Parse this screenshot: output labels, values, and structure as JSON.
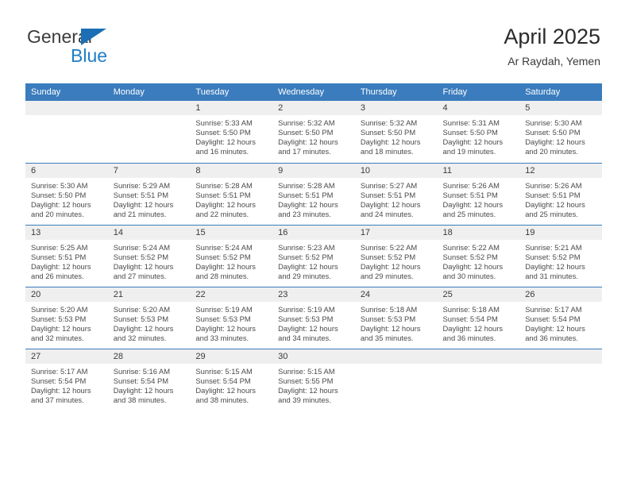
{
  "brand": {
    "line1": "General",
    "line2": "Blue",
    "triangle_color": "#1c6fb5",
    "line2_color": "#1f7ec4"
  },
  "header": {
    "title": "April 2025",
    "subtitle": "Ar Raydah, Yemen"
  },
  "colors": {
    "header_blue": "#3a7cbd",
    "daynum_band": "#efefef",
    "text": "#4a4a4a"
  },
  "weekdays": [
    "Sunday",
    "Monday",
    "Tuesday",
    "Wednesday",
    "Thursday",
    "Friday",
    "Saturday"
  ],
  "labels": {
    "sunrise": "Sunrise:",
    "sunset": "Sunset:",
    "daylight": "Daylight:"
  },
  "weeks": [
    [
      {
        "day": "",
        "sunrise": "",
        "sunset": "",
        "daylight_line1": "",
        "daylight_line2": ""
      },
      {
        "day": "",
        "sunrise": "",
        "sunset": "",
        "daylight_line1": "",
        "daylight_line2": ""
      },
      {
        "day": "1",
        "sunrise": "Sunrise: 5:33 AM",
        "sunset": "Sunset: 5:50 PM",
        "daylight_line1": "Daylight: 12 hours",
        "daylight_line2": "and 16 minutes."
      },
      {
        "day": "2",
        "sunrise": "Sunrise: 5:32 AM",
        "sunset": "Sunset: 5:50 PM",
        "daylight_line1": "Daylight: 12 hours",
        "daylight_line2": "and 17 minutes."
      },
      {
        "day": "3",
        "sunrise": "Sunrise: 5:32 AM",
        "sunset": "Sunset: 5:50 PM",
        "daylight_line1": "Daylight: 12 hours",
        "daylight_line2": "and 18 minutes."
      },
      {
        "day": "4",
        "sunrise": "Sunrise: 5:31 AM",
        "sunset": "Sunset: 5:50 PM",
        "daylight_line1": "Daylight: 12 hours",
        "daylight_line2": "and 19 minutes."
      },
      {
        "day": "5",
        "sunrise": "Sunrise: 5:30 AM",
        "sunset": "Sunset: 5:50 PM",
        "daylight_line1": "Daylight: 12 hours",
        "daylight_line2": "and 20 minutes."
      }
    ],
    [
      {
        "day": "6",
        "sunrise": "Sunrise: 5:30 AM",
        "sunset": "Sunset: 5:50 PM",
        "daylight_line1": "Daylight: 12 hours",
        "daylight_line2": "and 20 minutes."
      },
      {
        "day": "7",
        "sunrise": "Sunrise: 5:29 AM",
        "sunset": "Sunset: 5:51 PM",
        "daylight_line1": "Daylight: 12 hours",
        "daylight_line2": "and 21 minutes."
      },
      {
        "day": "8",
        "sunrise": "Sunrise: 5:28 AM",
        "sunset": "Sunset: 5:51 PM",
        "daylight_line1": "Daylight: 12 hours",
        "daylight_line2": "and 22 minutes."
      },
      {
        "day": "9",
        "sunrise": "Sunrise: 5:28 AM",
        "sunset": "Sunset: 5:51 PM",
        "daylight_line1": "Daylight: 12 hours",
        "daylight_line2": "and 23 minutes."
      },
      {
        "day": "10",
        "sunrise": "Sunrise: 5:27 AM",
        "sunset": "Sunset: 5:51 PM",
        "daylight_line1": "Daylight: 12 hours",
        "daylight_line2": "and 24 minutes."
      },
      {
        "day": "11",
        "sunrise": "Sunrise: 5:26 AM",
        "sunset": "Sunset: 5:51 PM",
        "daylight_line1": "Daylight: 12 hours",
        "daylight_line2": "and 25 minutes."
      },
      {
        "day": "12",
        "sunrise": "Sunrise: 5:26 AM",
        "sunset": "Sunset: 5:51 PM",
        "daylight_line1": "Daylight: 12 hours",
        "daylight_line2": "and 25 minutes."
      }
    ],
    [
      {
        "day": "13",
        "sunrise": "Sunrise: 5:25 AM",
        "sunset": "Sunset: 5:51 PM",
        "daylight_line1": "Daylight: 12 hours",
        "daylight_line2": "and 26 minutes."
      },
      {
        "day": "14",
        "sunrise": "Sunrise: 5:24 AM",
        "sunset": "Sunset: 5:52 PM",
        "daylight_line1": "Daylight: 12 hours",
        "daylight_line2": "and 27 minutes."
      },
      {
        "day": "15",
        "sunrise": "Sunrise: 5:24 AM",
        "sunset": "Sunset: 5:52 PM",
        "daylight_line1": "Daylight: 12 hours",
        "daylight_line2": "and 28 minutes."
      },
      {
        "day": "16",
        "sunrise": "Sunrise: 5:23 AM",
        "sunset": "Sunset: 5:52 PM",
        "daylight_line1": "Daylight: 12 hours",
        "daylight_line2": "and 29 minutes."
      },
      {
        "day": "17",
        "sunrise": "Sunrise: 5:22 AM",
        "sunset": "Sunset: 5:52 PM",
        "daylight_line1": "Daylight: 12 hours",
        "daylight_line2": "and 29 minutes."
      },
      {
        "day": "18",
        "sunrise": "Sunrise: 5:22 AM",
        "sunset": "Sunset: 5:52 PM",
        "daylight_line1": "Daylight: 12 hours",
        "daylight_line2": "and 30 minutes."
      },
      {
        "day": "19",
        "sunrise": "Sunrise: 5:21 AM",
        "sunset": "Sunset: 5:52 PM",
        "daylight_line1": "Daylight: 12 hours",
        "daylight_line2": "and 31 minutes."
      }
    ],
    [
      {
        "day": "20",
        "sunrise": "Sunrise: 5:20 AM",
        "sunset": "Sunset: 5:53 PM",
        "daylight_line1": "Daylight: 12 hours",
        "daylight_line2": "and 32 minutes."
      },
      {
        "day": "21",
        "sunrise": "Sunrise: 5:20 AM",
        "sunset": "Sunset: 5:53 PM",
        "daylight_line1": "Daylight: 12 hours",
        "daylight_line2": "and 32 minutes."
      },
      {
        "day": "22",
        "sunrise": "Sunrise: 5:19 AM",
        "sunset": "Sunset: 5:53 PM",
        "daylight_line1": "Daylight: 12 hours",
        "daylight_line2": "and 33 minutes."
      },
      {
        "day": "23",
        "sunrise": "Sunrise: 5:19 AM",
        "sunset": "Sunset: 5:53 PM",
        "daylight_line1": "Daylight: 12 hours",
        "daylight_line2": "and 34 minutes."
      },
      {
        "day": "24",
        "sunrise": "Sunrise: 5:18 AM",
        "sunset": "Sunset: 5:53 PM",
        "daylight_line1": "Daylight: 12 hours",
        "daylight_line2": "and 35 minutes."
      },
      {
        "day": "25",
        "sunrise": "Sunrise: 5:18 AM",
        "sunset": "Sunset: 5:54 PM",
        "daylight_line1": "Daylight: 12 hours",
        "daylight_line2": "and 36 minutes."
      },
      {
        "day": "26",
        "sunrise": "Sunrise: 5:17 AM",
        "sunset": "Sunset: 5:54 PM",
        "daylight_line1": "Daylight: 12 hours",
        "daylight_line2": "and 36 minutes."
      }
    ],
    [
      {
        "day": "27",
        "sunrise": "Sunrise: 5:17 AM",
        "sunset": "Sunset: 5:54 PM",
        "daylight_line1": "Daylight: 12 hours",
        "daylight_line2": "and 37 minutes."
      },
      {
        "day": "28",
        "sunrise": "Sunrise: 5:16 AM",
        "sunset": "Sunset: 5:54 PM",
        "daylight_line1": "Daylight: 12 hours",
        "daylight_line2": "and 38 minutes."
      },
      {
        "day": "29",
        "sunrise": "Sunrise: 5:15 AM",
        "sunset": "Sunset: 5:54 PM",
        "daylight_line1": "Daylight: 12 hours",
        "daylight_line2": "and 38 minutes."
      },
      {
        "day": "30",
        "sunrise": "Sunrise: 5:15 AM",
        "sunset": "Sunset: 5:55 PM",
        "daylight_line1": "Daylight: 12 hours",
        "daylight_line2": "and 39 minutes."
      },
      {
        "day": "",
        "sunrise": "",
        "sunset": "",
        "daylight_line1": "",
        "daylight_line2": ""
      },
      {
        "day": "",
        "sunrise": "",
        "sunset": "",
        "daylight_line1": "",
        "daylight_line2": ""
      },
      {
        "day": "",
        "sunrise": "",
        "sunset": "",
        "daylight_line1": "",
        "daylight_line2": ""
      }
    ]
  ]
}
